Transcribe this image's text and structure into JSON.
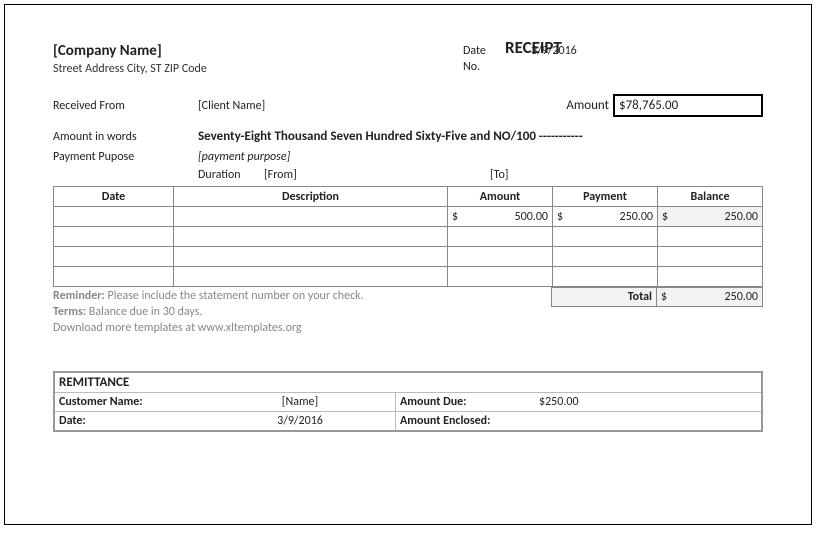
{
  "header": {
    "company_name": "[Company Name]",
    "address": "Street Address City, ST ZIP Code",
    "title": "RECEIPT"
  },
  "meta": {
    "date_label": "Date",
    "no_label": "No.",
    "date_value": "3/9/2016",
    "no_value": ""
  },
  "fields": {
    "received_from_label": "Received From",
    "received_from_value": "[Client Name]",
    "amount_label": "Amount",
    "amount_value": "$78,765.00",
    "amount_words_label": "Amount in words",
    "amount_words_value": "Seventy-Eight Thousand Seven Hundred Sixty-Five and NO/100 -----------",
    "payment_purpose_label": "Payment Pupose",
    "payment_purpose_value": "[payment purpose]",
    "duration_label": "Duration",
    "from_label": "[From]",
    "to_label": "[To]"
  },
  "table": {
    "headers": {
      "date": "Date",
      "desc": "Description",
      "amount": "Amount",
      "payment": "Payment",
      "balance": "Balance"
    },
    "rows": [
      {
        "date": "",
        "desc": "",
        "amount_sym": "$",
        "amount_num": "500.00",
        "payment_sym": "$",
        "payment_num": "250.00",
        "balance_sym": "$",
        "balance_num": "250.00",
        "bal_shade": true
      },
      {
        "date": "",
        "desc": "",
        "amount_sym": "",
        "amount_num": "",
        "payment_sym": "",
        "payment_num": "",
        "balance_sym": "",
        "balance_num": "",
        "bal_shade": false
      },
      {
        "date": "",
        "desc": "",
        "amount_sym": "",
        "amount_num": "",
        "payment_sym": "",
        "payment_num": "",
        "balance_sym": "",
        "balance_num": "",
        "bal_shade": false
      },
      {
        "date": "",
        "desc": "",
        "amount_sym": "",
        "amount_num": "",
        "payment_sym": "",
        "payment_num": "",
        "balance_sym": "",
        "balance_num": "",
        "bal_shade": false
      }
    ],
    "total_label": "Total",
    "total_sym": "$",
    "total_num": "250.00"
  },
  "notes": {
    "reminder_label": "Reminder:",
    "reminder_text": " Please include the statement number on your check.",
    "terms_label": "Terms:",
    "terms_text": " Balance due in 30 days.",
    "download": "Download more templates at www.xltemplates.org"
  },
  "remittance": {
    "title": "REMITTANCE",
    "customer_label": "Customer Name:",
    "customer_value": "[Name]",
    "amount_due_label": "Amount Due:",
    "amount_due_value": "$250.00",
    "date_label": "Date:",
    "date_value": "3/9/2016",
    "enclosed_label": "Amount Enclosed:",
    "enclosed_value": ""
  }
}
